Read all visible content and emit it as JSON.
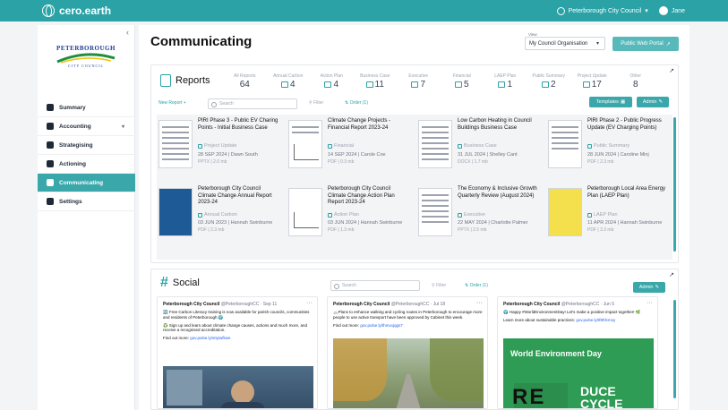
{
  "app": {
    "brand": "cero.earth",
    "org": "Peterborough City Council",
    "user": "Jane"
  },
  "sidebar": {
    "logo_top": "PETERBOROUGH",
    "logo_bottom": "CITY COUNCIL",
    "items": [
      {
        "label": "Summary",
        "icon": "summary-icon"
      },
      {
        "label": "Accounting",
        "icon": "accounting-icon",
        "has_submenu": true
      },
      {
        "label": "Strategising",
        "icon": "strategy-icon"
      },
      {
        "label": "Actioning",
        "icon": "actioning-icon"
      },
      {
        "label": "Communicating",
        "icon": "communicating-icon",
        "active": true
      },
      {
        "label": "Settings",
        "icon": "gear-icon"
      }
    ]
  },
  "main": {
    "title": "Communicating",
    "view_label": "View",
    "view_value": "My Council Organisation",
    "public_portal": "Public Web Portal"
  },
  "reports": {
    "title": "Reports",
    "stats": [
      {
        "label": "All Reports",
        "value": "64"
      },
      {
        "label": "Annual Carbon",
        "value": "4"
      },
      {
        "label": "Action Plan",
        "value": "4"
      },
      {
        "label": "Business Case",
        "value": "11"
      },
      {
        "label": "Executive",
        "value": "7"
      },
      {
        "label": "Financial",
        "value": "5"
      },
      {
        "label": "LAEP Plan",
        "value": "1"
      },
      {
        "label": "Public Summary",
        "value": "2"
      },
      {
        "label": "Project Update",
        "value": "17"
      },
      {
        "label": "Other",
        "value": "8"
      }
    ],
    "new_report": "New Report",
    "search_placeholder": "Search",
    "filter": "Filter",
    "order": "Order (1)",
    "templates": "Templates",
    "admin": "Admin",
    "cards": [
      {
        "title": "PIRI Phase 3 - Public EV Charing Points - Initial Business Case",
        "category": "Project Update",
        "date": "28 SEP 2024 | Dawn South",
        "size": "PPTX | 2.0 mb"
      },
      {
        "title": "Climate Change Projects - Financial Report 2023-24",
        "category": "Financial",
        "date": "14 SEP 2024 | Carole Coe",
        "size": "PDF | 0.3 mb"
      },
      {
        "title": "Low Carbon Heating in Council Buildings Business Case",
        "category": "Business Case",
        "date": "31 JUL 2024 | Shelley Cant",
        "size": "DOCX | 1.7 mb"
      },
      {
        "title": "PIRI Phase 2 - Public Progress Update (EV Charging Points)",
        "category": "Public Summary",
        "date": "28 JUN 2024 | Caroline Minj",
        "size": "PDF | 2.3 mb"
      },
      {
        "title": "Peterborough City Council Climate Change Annual Report 2023-24",
        "category": "Annual Carbon",
        "date": "03 JUN 2023 | Hannah Swinburne",
        "size": "PDF | 2.3 mb"
      },
      {
        "title": "Peterborough City Council Climate Change Action Plan Report 2023-24",
        "category": "Action Plan",
        "date": "03 JUN 2024 | Hannah Swinburne",
        "size": "PDF | 1.3 mb"
      },
      {
        "title": "The Economy & Inclusive Growth Quarterly Review (August 2024)",
        "category": "Executive",
        "date": "22 MAY 2024 | Charlotte Palmer",
        "size": "PPTX | 2.5 mb"
      },
      {
        "title": "Peterborough Local Area Energy Plan (LAEP Plan)",
        "category": "LAEP Plan",
        "date": "11 APR 2024 | Hannah Swinburne",
        "size": "PDF | 3.3 mb"
      }
    ]
  },
  "social": {
    "title": "Social",
    "search_placeholder": "Search",
    "filter": "Filter",
    "order": "Order (1)",
    "admin": "Admin",
    "posts": [
      {
        "author": "Peterborough City Council",
        "handle": "@PeterboroughCC · Sep 11",
        "text": "🆓 Free Carbon Literacy training is now available for parish councils, communities and residents of Peterborough 🌍",
        "text2": "♻️ Sign up and learn about climate change causes, actions and much more, and receive a recognised accreditation.",
        "text3": "Find out more:",
        "link": "gov.pulse.ly/s0yiwfkwe"
      },
      {
        "author": "Peterborough City Council",
        "handle": "@PeterboroughCC · Jul 18",
        "text": "🚲Plans to enhance walking and cycling routes in Peterborough to encourage more people to use active transport have been approved by Cabinet this week.",
        "text2": "Find out more:",
        "link": "gov.pulse.ly/thmxxjqgs7"
      },
      {
        "author": "Peterborough City Council",
        "handle": "@PeterboroughCC · Jun 5",
        "text": "🌍 Happy #WorldEnvironmentDay! Let's make a positive impact together! 🌿",
        "text2": "Learn more about sustainable practices:",
        "link": "gov.pulse.ly/tf8hfcmxy",
        "img_title": "World Environment Day",
        "img_big": "RE",
        "img_sm1": "DUCE",
        "img_sm2": "CYCLE"
      }
    ]
  }
}
